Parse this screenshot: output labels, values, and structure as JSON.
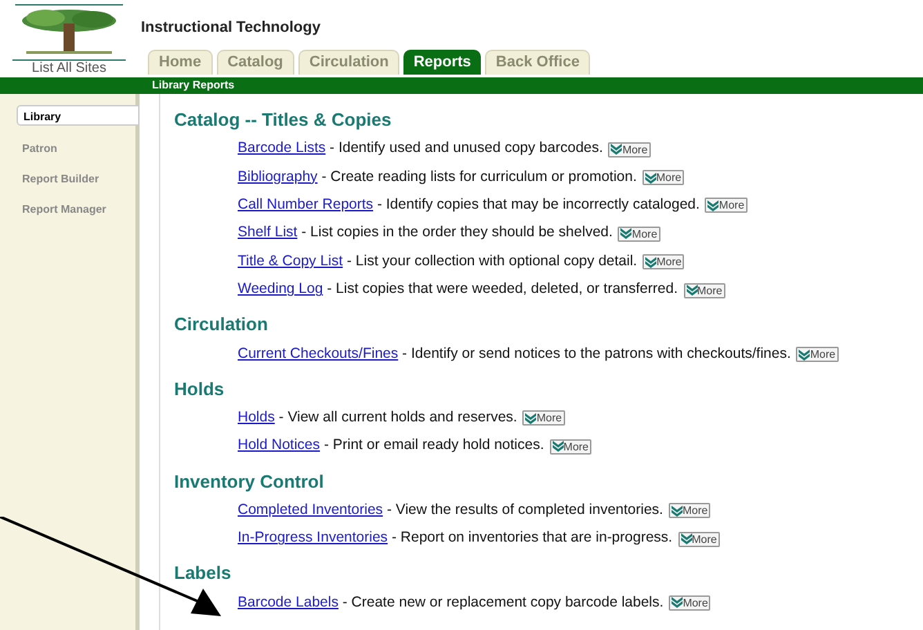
{
  "header": {
    "site_title": "Instructional Technology",
    "site_link": "List All Sites"
  },
  "tabs": [
    {
      "label": "Home",
      "selected": false
    },
    {
      "label": "Catalog",
      "selected": false
    },
    {
      "label": "Circulation",
      "selected": false
    },
    {
      "label": "Reports",
      "selected": true
    },
    {
      "label": "Back Office",
      "selected": false
    }
  ],
  "subnav": {
    "label": "Library Reports"
  },
  "sidebar": {
    "items": [
      {
        "label": "Library",
        "selected": true
      },
      {
        "label": "Patron",
        "selected": false
      },
      {
        "label": "Report Builder",
        "selected": false
      },
      {
        "label": "Report Manager",
        "selected": false
      }
    ]
  },
  "sections": [
    {
      "heading": "Catalog -- Titles & Copies",
      "reports": [
        {
          "link": "Barcode Lists",
          "description": " - Identify used and unused copy barcodes.",
          "more": "More"
        },
        {
          "link": "Bibliography",
          "description": " - Create reading lists for curriculum or promotion.",
          "more": "More"
        },
        {
          "link": "Call Number Reports",
          "description": " - Identify copies that may be incorrectly cataloged.",
          "more": "More"
        },
        {
          "link": "Shelf List",
          "description": " - List copies in the order they should be shelved.",
          "more": "More"
        },
        {
          "link": "Title & Copy List",
          "description": " - List your collection with optional copy detail.",
          "more": "More"
        },
        {
          "link": "Weeding Log",
          "description": " - List copies that were weeded, deleted, or transferred.",
          "more": "More"
        }
      ]
    },
    {
      "heading": "Circulation",
      "reports": [
        {
          "link": "Current Checkouts/Fines",
          "description": " - Identify or send notices to the patrons with checkouts/fines.",
          "more": "More"
        }
      ]
    },
    {
      "heading": "Holds",
      "reports": [
        {
          "link": "Holds",
          "description": " - View all current holds and reserves.",
          "more": "More"
        },
        {
          "link": "Hold Notices",
          "description": " - Print or email ready hold notices.",
          "more": "More"
        }
      ]
    },
    {
      "heading": "Inventory Control",
      "reports": [
        {
          "link": "Completed Inventories",
          "description": " - View the results of completed inventories.",
          "more": "More"
        },
        {
          "link": "In-Progress Inventories",
          "description": " - Report on inventories that are in-progress.",
          "more": "More"
        }
      ]
    },
    {
      "heading": "Labels",
      "reports": [
        {
          "link": "Barcode Labels",
          "description": " - Create new or replacement copy barcode labels.",
          "more": "More"
        }
      ]
    }
  ]
}
